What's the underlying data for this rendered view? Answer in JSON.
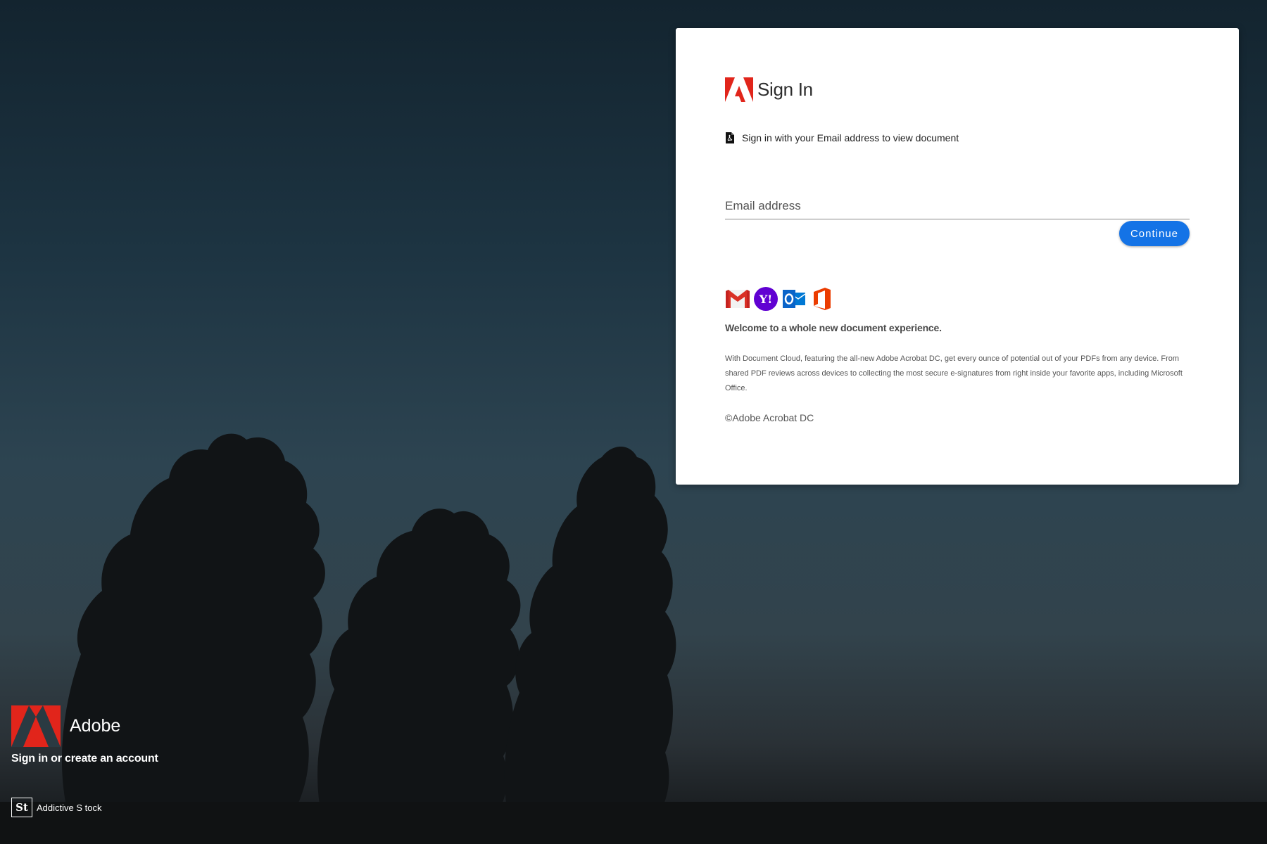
{
  "signin_card": {
    "title": "Sign In",
    "instruction": "Sign in with your Email address to view document",
    "email_placeholder": "Email address",
    "continue_label": "Continue",
    "providers": [
      "gmail-icon",
      "yahoo-icon",
      "outlook-icon",
      "office-icon"
    ],
    "welcome_heading": "Welcome to a whole new document experience.",
    "description": "With Document Cloud, featuring the all-new Adobe Acrobat DC, get every ounce of potential out of your PDFs from any device. From shared PDF reviews across devices to collecting the most secure e-signatures from right inside your favorite apps, including Microsoft Office.",
    "copyright": "©Adobe Acrobat DC"
  },
  "brand": {
    "name": "Adobe",
    "tagline": "Sign in or create an account",
    "credit_badge": "St",
    "credit_text": "Addictive S tock"
  },
  "colors": {
    "adobe_red": "#e1251b",
    "button_blue": "#1473e6",
    "card_background": "#ffffff"
  }
}
